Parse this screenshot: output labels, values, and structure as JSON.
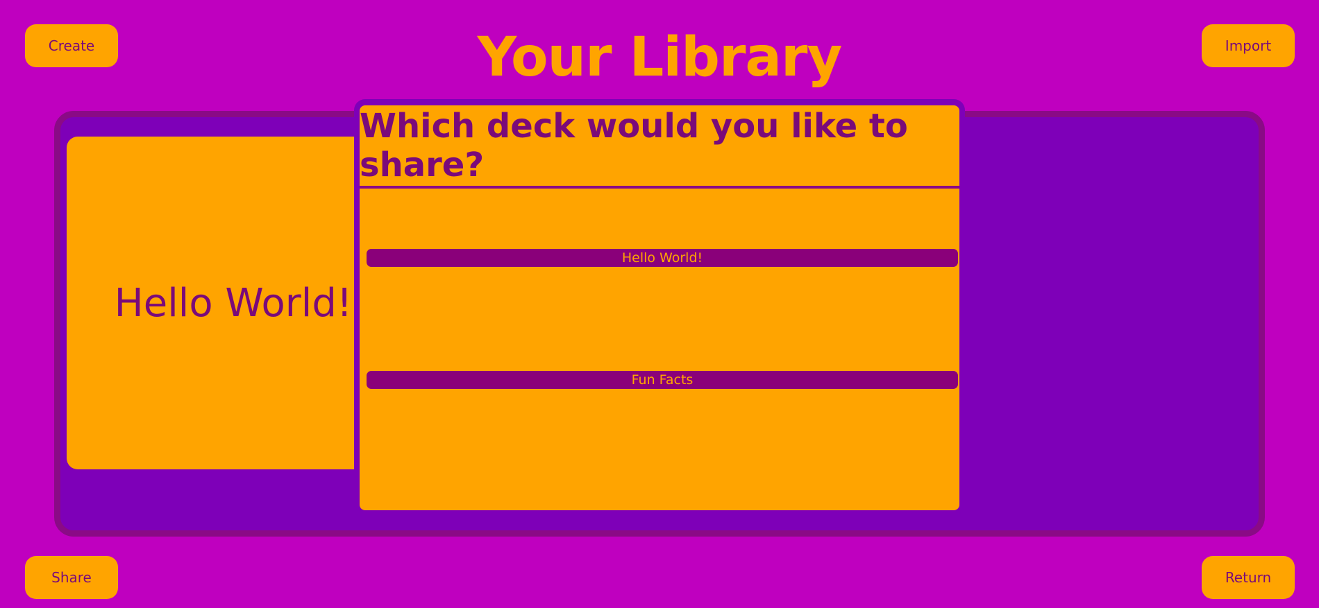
{
  "header": {
    "title": "Your Library",
    "create_label": "Create",
    "import_label": "Import"
  },
  "footer": {
    "share_label": "Share",
    "return_label": "Return"
  },
  "library": {
    "decks": [
      {
        "title": "Hello World!"
      }
    ]
  },
  "share_modal": {
    "title": "Which deck would you like to share?",
    "options": [
      {
        "label": "Hello World!"
      },
      {
        "label": "Fun Facts"
      }
    ]
  },
  "colors": {
    "background": "#bf00bf",
    "accent": "#ffa400",
    "panel": "#7e00b8",
    "text": "#7a0a7a",
    "option_bar": "#8a007a"
  }
}
